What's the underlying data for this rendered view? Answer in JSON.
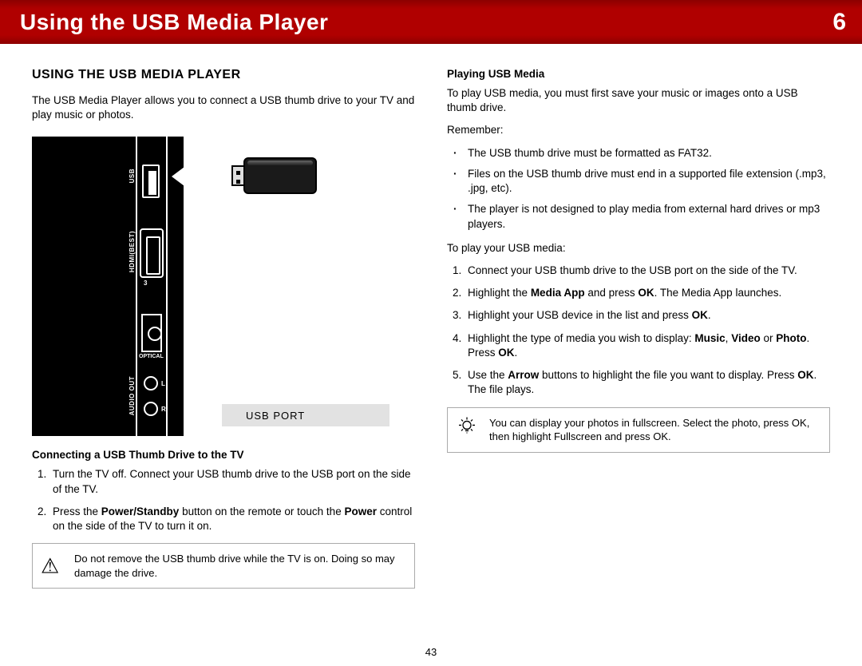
{
  "banner": {
    "title": "Using the USB Media Player",
    "chapter": "6"
  },
  "left": {
    "heading": "USING THE USB MEDIA PLAYER",
    "intro": "The USB Media Player allows you to connect a USB thumb drive to your TV and play music or photos.",
    "diagram": {
      "usb_label": "USB",
      "hdmi_label": "HDMI(BEST)",
      "hdmi_num": "3",
      "optical_label": "OPTICAL",
      "audio_label": "AUDIO OUT",
      "L": "L",
      "R": "R",
      "caption": "USB PORT"
    },
    "sub": "Connecting a USB Thumb Drive to the TV",
    "step1": "Turn the TV off. Connect your USB thumb drive to the USB port on the side of the TV.",
    "step2_a": "Press the ",
    "step2_b": "Power/Standby",
    "step2_c": " button on the remote or touch the ",
    "step2_d": "Power",
    "step2_e": " control on the side of the TV to turn it on.",
    "warn": "Do not remove the USB thumb drive while the TV is on. Doing so may damage the drive."
  },
  "right": {
    "sub": "Playing USB Media",
    "intro": "To play USB media, you must first save your music or images onto a USB thumb drive.",
    "remember_label": "Remember:",
    "remember": [
      "The USB thumb drive must be formatted as FAT32.",
      "Files on the USB thumb drive must end in a supported file extension (.mp3, .jpg, etc).",
      "The player is not designed to play media from external hard drives or mp3 players."
    ],
    "play_label": "To play your USB media:",
    "s1": "Connect your USB thumb drive to the USB port on the side of the TV.",
    "s2_a": "Highlight the ",
    "s2_b": "Media App",
    "s2_c": " and press ",
    "s2_d": "OK",
    "s2_e": ". The Media App launches.",
    "s3_a": "Highlight your USB device in the list and press ",
    "s3_b": "OK",
    "s3_c": ".",
    "s4_a": "Highlight the type of media you wish to display: ",
    "s4_b": "Music",
    "s4_c": ", ",
    "s4_d": "Video",
    "s4_e": " or ",
    "s4_f": "Photo",
    "s4_g": ". Press ",
    "s4_h": "OK",
    "s4_i": ".",
    "s5_a": "Use the ",
    "s5_b": "Arrow",
    "s5_c": " buttons to highlight the file you want to display. Press ",
    "s5_d": "OK",
    "s5_e": ". The file plays.",
    "tip": "You can display your photos in fullscreen. Select the photo, press OK, then highlight Fullscreen and press OK."
  },
  "page_number": "43"
}
